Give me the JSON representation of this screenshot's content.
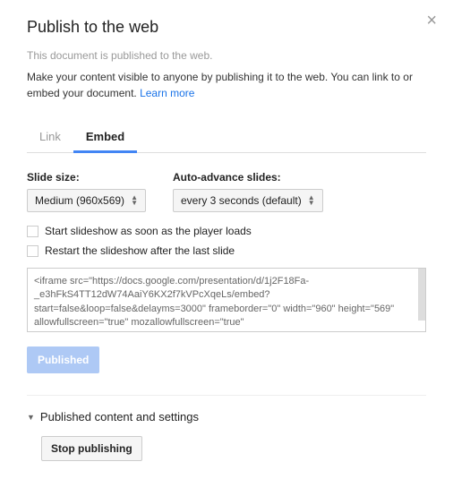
{
  "dialog": {
    "title": "Publish to the web",
    "subtitle": "This document is published to the web.",
    "description": "Make your content visible to anyone by publishing it to the web. You can link to or embed your document. ",
    "learn_more": "Learn more"
  },
  "tabs": {
    "link": "Link",
    "embed": "Embed"
  },
  "slide_size": {
    "label": "Slide size:",
    "value": "Medium (960x569)"
  },
  "auto_advance": {
    "label": "Auto-advance slides:",
    "value": "every 3 seconds (default)"
  },
  "checkboxes": {
    "start_on_load": "Start slideshow as soon as the player loads",
    "restart_after_last": "Restart the slideshow after the last slide"
  },
  "embed_code": "<iframe src=\"https://docs.google.com/presentation/d/1j2F18Fa-_e3hFkS4TT12dW74AaiY6KX2f7kVPcXqeLs/embed?start=false&loop=false&delayms=3000\" frameborder=\"0\" width=\"960\" height=\"569\" allowfullscreen=\"true\" mozallowfullscreen=\"true\"",
  "buttons": {
    "published": "Published",
    "stop_publishing": "Stop publishing"
  },
  "footer": {
    "expand_label": "Published content and settings"
  }
}
